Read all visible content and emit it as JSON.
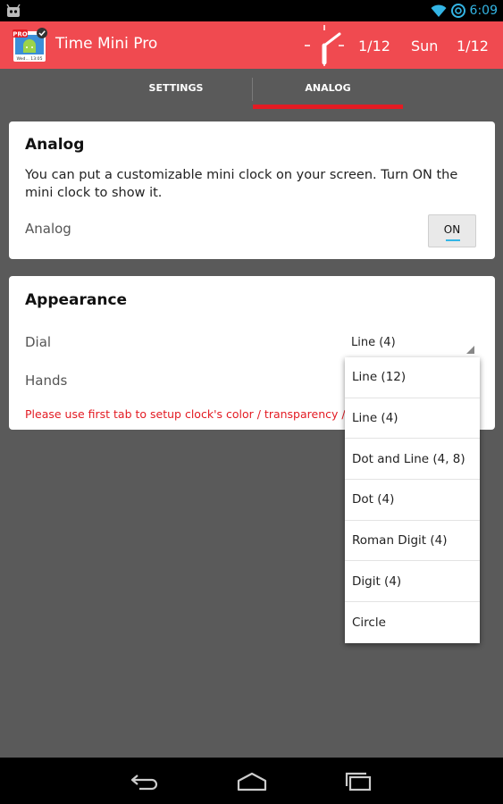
{
  "status_bar": {
    "time": "6:09"
  },
  "action_bar": {
    "title": "Time Mini Pro",
    "icon_badge": "PRO",
    "icon_caption": "Wed... 13:05",
    "date": "1/12",
    "day": "Sun",
    "date2": "1/12"
  },
  "tabs": [
    {
      "label": "SETTINGS"
    },
    {
      "label": "ANALOG",
      "selected": true
    }
  ],
  "analog_card": {
    "title": "Analog",
    "description": "You can put a customizable mini clock on your screen. Turn ON the mini clock to show it.",
    "toggle_label": "Analog",
    "toggle_state": "ON"
  },
  "appearance_card": {
    "title": "Appearance",
    "dial_label": "Dial",
    "dial_value": "Line (4)",
    "hands_label": "Hands",
    "warning": "Please use first tab to setup clock's color / transparency / ..."
  },
  "dropdown": {
    "options": [
      "Line (12)",
      "Line (4)",
      "Dot and Line (4, 8)",
      "Dot (4)",
      "Roman Digit (4)",
      "Digit (4)",
      "Circle"
    ]
  },
  "colors": {
    "accent": "#f04a50",
    "tab_indicator": "#e31b23",
    "warning": "#e31b23",
    "status_accent": "#33b5e5",
    "background": "#5a5a5a"
  },
  "icons": [
    "android-debug-icon",
    "wifi-icon",
    "sync-icon",
    "app-icon",
    "mini-clock-icon",
    "back-icon",
    "home-icon",
    "recents-icon"
  ]
}
